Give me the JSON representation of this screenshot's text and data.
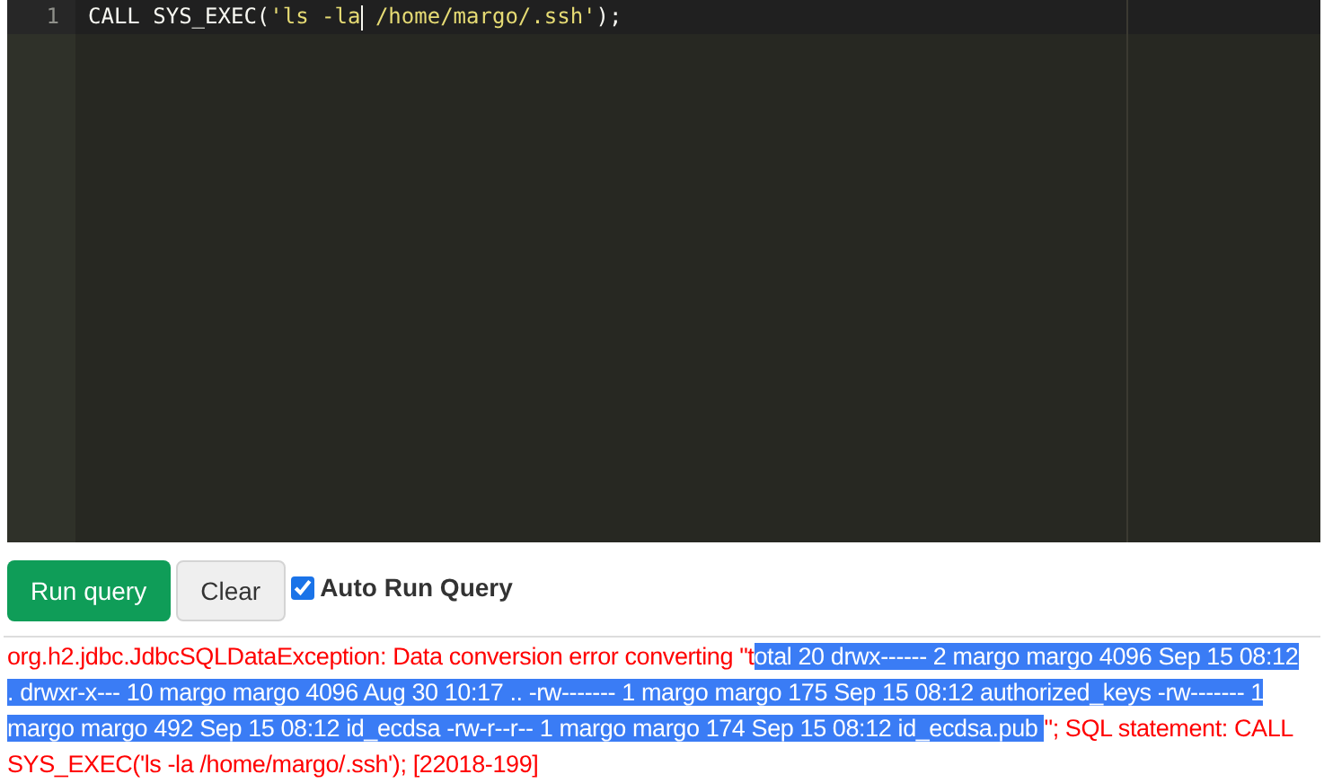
{
  "editor": {
    "lines": [
      {
        "number": "1",
        "tokens": [
          {
            "kind": "plain",
            "text": "CALL SYS_EXEC("
          },
          {
            "kind": "string",
            "text": "'ls -la"
          },
          {
            "kind": "cursor"
          },
          {
            "kind": "string",
            "text": " /home/margo/.ssh'"
          },
          {
            "kind": "plain",
            "text": ");"
          }
        ]
      }
    ]
  },
  "buttons": [
    {
      "label": "Run query",
      "kind": "primary"
    },
    {
      "label": "Clear",
      "kind": "default"
    }
  ],
  "auto_run": {
    "label": "Auto Run Query",
    "checked": true
  },
  "error": {
    "before": "org.h2.jdbc.JdbcSQLDataException: Data conversion error converting \"t",
    "selected": "otal 20 drwx------ 2 margo margo 4096 Sep 15 08:12 . drwxr-x--- 10 margo margo 4096 Aug 30 10:17 .. -rw------- 1 margo margo 175 Sep 15 08:12 authorized_keys -rw------- 1 margo margo 492 Sep 15 08:12 id_ecdsa -rw-r--r-- 1 margo margo 174 Sep 15 08:12 id_ecdsa.pub ",
    "after": "\"; SQL statement: CALL SYS_EXEC('ls -la /home/margo/.ssh'); [22018-199]"
  }
}
